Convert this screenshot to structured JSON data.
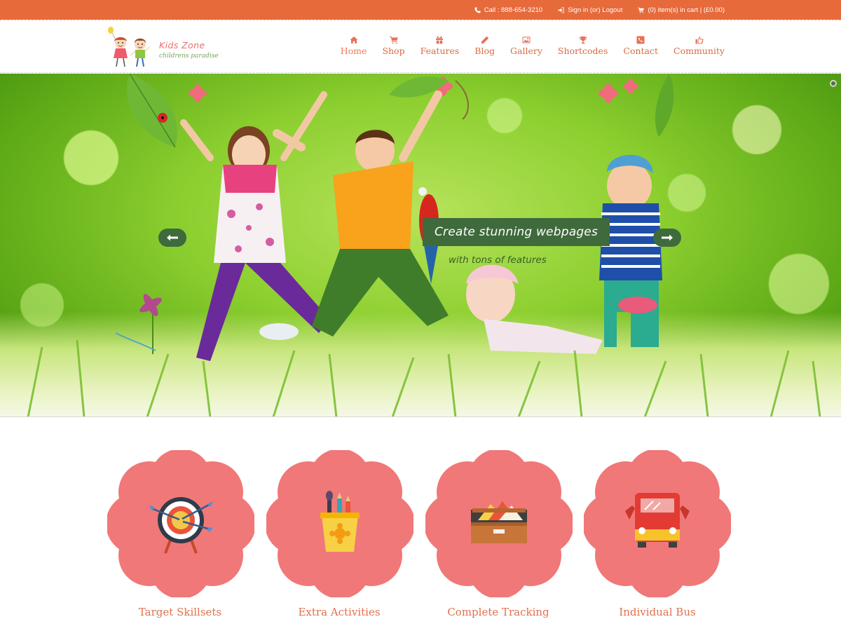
{
  "topbar": {
    "phone": "Call : 888-654-3210",
    "auth": "Sign in (or) Logout",
    "cart": "(0) item(s) in cart | (£0.00)"
  },
  "logo": {
    "title": "Kids Zone",
    "subtitle": "childrens paradise"
  },
  "nav": {
    "items": [
      {
        "label": "Home",
        "icon": "home-icon",
        "active": true
      },
      {
        "label": "Shop",
        "icon": "cart-icon"
      },
      {
        "label": "Features",
        "icon": "gift-icon"
      },
      {
        "label": "Blog",
        "icon": "pencil-icon"
      },
      {
        "label": "Gallery",
        "icon": "image-icon"
      },
      {
        "label": "Shortcodes",
        "icon": "trophy-icon"
      },
      {
        "label": "Contact",
        "icon": "phone-icon"
      },
      {
        "label": "Community",
        "icon": "thumbs-up-icon"
      }
    ]
  },
  "hero": {
    "caption_title": "Create stunning webpages",
    "caption_subtitle": "with tons of features"
  },
  "features": [
    {
      "label": "Target Skillsets",
      "icon": "target-icon"
    },
    {
      "label": "Extra Activities",
      "icon": "pencil-cup-icon"
    },
    {
      "label": "Complete Tracking",
      "icon": "drawer-icon"
    },
    {
      "label": "Individual Bus",
      "icon": "bus-icon"
    }
  ],
  "colors": {
    "topbar": "#e76a3b",
    "nav_text": "#d96a43",
    "flower": "#f07878",
    "caption_bg": "#3f6a3c",
    "feature_label": "#e0714e"
  }
}
